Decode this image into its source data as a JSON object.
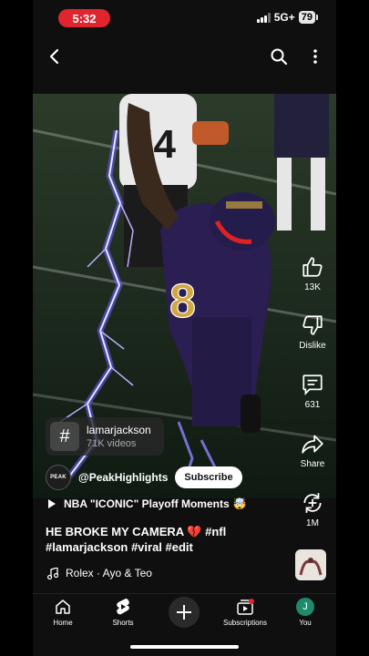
{
  "status": {
    "time": "5:32",
    "network": "5G+",
    "battery": "79"
  },
  "topbar": {
    "back_icon": "chevron-left-icon",
    "search_icon": "search-icon",
    "more_icon": "more-vert-icon"
  },
  "actions": {
    "like_count": "13K",
    "dislike_label": "Dislike",
    "comment_count": "631",
    "share_label": "Share",
    "remix_count": "1M"
  },
  "hashtag": {
    "name": "lamarjackson",
    "videos": "71K videos"
  },
  "channel": {
    "avatar_text": "PEAK",
    "handle": "@PeakHighlights",
    "subscribe_label": "Subscribe"
  },
  "playlist": {
    "label": "NBA \"ICONIC\" Playoff Moments",
    "emoji": "🤯"
  },
  "title": {
    "text": "HE BROKE MY CAMERA",
    "emoji": "💔",
    "tags": "#nfl #lamarjackson #viral #edit"
  },
  "song": {
    "label": "Rolex · Ayo & Teo"
  },
  "jersey_number": "8",
  "nav": {
    "home": "Home",
    "shorts": "Shorts",
    "subscriptions": "Subscriptions",
    "you": "You",
    "you_initial": "J"
  },
  "colors": {
    "accent_red": "#e0252f",
    "avatar_green": "#1f8a6b",
    "lightning": "#6a5cff"
  }
}
